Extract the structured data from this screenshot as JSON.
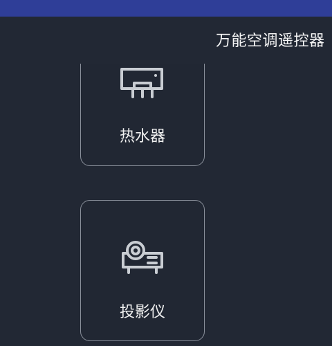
{
  "header": {
    "title": "万能空调遥控器"
  },
  "devices": [
    {
      "label": "热水器",
      "icon": "water-heater-icon"
    },
    {
      "label": "投影仪",
      "icon": "projector-icon"
    }
  ]
}
